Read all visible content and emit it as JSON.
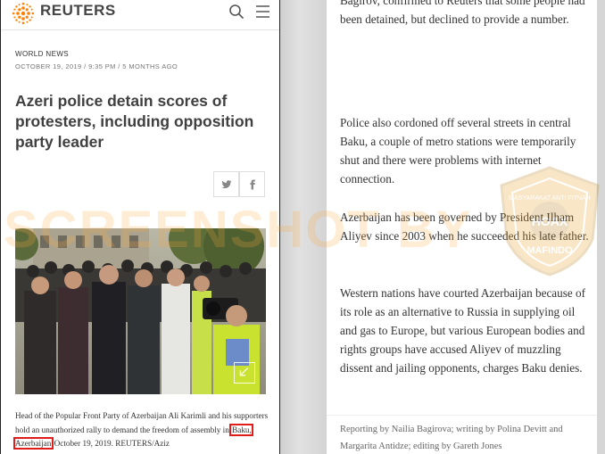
{
  "left": {
    "brand": "REUTERS",
    "section": "WORLD NEWS",
    "dateline": "OCTOBER 19, 2019 / 9:35 PM / 5 MONTHS AGO",
    "headline": "Azeri police detain scores of protesters, including opposition party leader",
    "caption_before": "Head of the Popular Front Party of Azerbaijan Ali Karimli and his supporters hold an unauthorized rally to demand the freedom of assembly in ",
    "caption_highlight": "Baku, Azerbaijan",
    "caption_after": " October 19, 2019. REUTERS/Aziz"
  },
  "right": {
    "para0": "Bagirov, confirmed to Reuters that some people had been detained, but declined to provide a number.",
    "para1": "Police also cordoned off several streets in central Baku, a couple of metro stations were temporarily shut and there were problems with internet connection.",
    "para2": "Azerbaijan has been governed by President Ilham Aliyev since 2003 when he succeeded his late father.",
    "para3": "Western nations have courted Azerbaijan because of its role as an alternative to Russia in supplying oil and gas to Europe, but various European bodies and rights groups have accused Aliyev of muzzling dissent and jailing opponents, charges Baku denies.",
    "credits": "Reporting by Nailia Bagirova; writing by Polina Devitt and Margarita Antidze; editing by Gareth Jones"
  },
  "watermark": {
    "text": "SCREENSHOT BY",
    "seal_text": "MASYARAKAT ANTI FITNAH INDONESIA",
    "seal_bottom": "MAFINDO"
  },
  "colors": {
    "brand_orange": "#ff8000",
    "highlight_box": "#e21b1b"
  },
  "icons": [
    "reuters-logo-icon",
    "search-icon",
    "menu-icon",
    "twitter-icon",
    "facebook-icon",
    "expand-icon"
  ]
}
